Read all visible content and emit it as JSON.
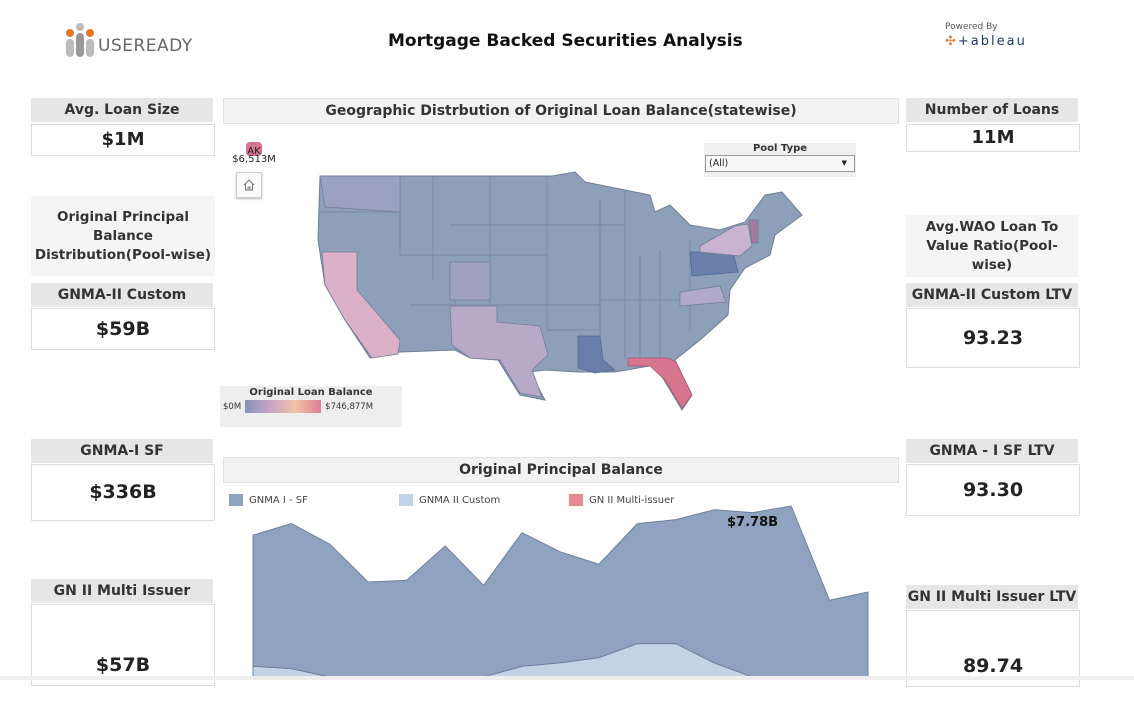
{
  "header": {
    "title": "Mortgage Backed Securities Analysis",
    "logo_text": "USEREADY",
    "powered_by": "Powered By",
    "tableau_text": "+ableau"
  },
  "left": {
    "avg_loan": {
      "label": "Avg. Loan Size",
      "value": "$1M"
    },
    "section_title": "Original Principal Balance Distribution(Pool-wise)",
    "kpis": [
      {
        "label": "GNMA-II Custom",
        "value": "$59B"
      },
      {
        "label": "GNMA-I SF",
        "value": "$336B"
      },
      {
        "label": "GN II Multi Issuer",
        "value": "$57B"
      }
    ]
  },
  "right": {
    "num_loans": {
      "label": "Number of Loans",
      "value": "11M"
    },
    "section_title": "Avg.WAO Loan To Value Ratio(Pool-wise)",
    "kpis": [
      {
        "label": "GNMA-II Custom LTV",
        "value": "93.23"
      },
      {
        "label": "GNMA - I SF LTV",
        "value": "93.30"
      },
      {
        "label": "GN II Multi Issuer LTV",
        "value": "89.74"
      }
    ]
  },
  "map": {
    "title": "Geographic Distrbution of Original Loan Balance(statewise)",
    "ak_label": "AK",
    "ak_value": "$6,513M",
    "filter": {
      "label": "Pool Type",
      "value": "(All)"
    },
    "legend": {
      "title": "Original Loan Balance",
      "min": "$0M",
      "max": "$746,877M"
    },
    "colors": {
      "base": "#8e9fba",
      "CA": "#dcb0c8",
      "TX": "#b8a9c9",
      "FL": "#d7758f",
      "LA": "#687da8",
      "PA": "#6a80a9",
      "NY": "#c9b2d2",
      "VT": "#a07ca0",
      "VA": "#b0a9c9",
      "WA": "#9ba1c1",
      "CO": "#9fa3c0"
    }
  },
  "chart_data": {
    "type": "area",
    "title": "Original Principal Balance",
    "stacked": true,
    "series": [
      {
        "name": "GNMA I - SF",
        "color": "#8fa2bf",
        "values": [
          5.96,
          6.6,
          6.04,
          4.32,
          4.4,
          5.96,
          4.17,
          6.08,
          5.04,
          4.25,
          5.46,
          5.64,
          6.97,
          7.48,
          7.78,
          3.49,
          3.87
        ]
      },
      {
        "name": "GNMA II Custom",
        "color": "#c2d3e6",
        "values": [
          0.49,
          0.38,
          0,
          0,
          0,
          0,
          0,
          0.49,
          0.65,
          0.88,
          1.52,
          1.52,
          0.64,
          0,
          0,
          0,
          0
        ]
      },
      {
        "name": "GN II Multi-issuer",
        "color": "#e78a92",
        "values": [
          0,
          0,
          0,
          0,
          0,
          0,
          0,
          0,
          0,
          0,
          0,
          0,
          0,
          0,
          0,
          0,
          0
        ]
      }
    ],
    "annotation": "$7.78B",
    "grid": false
  }
}
